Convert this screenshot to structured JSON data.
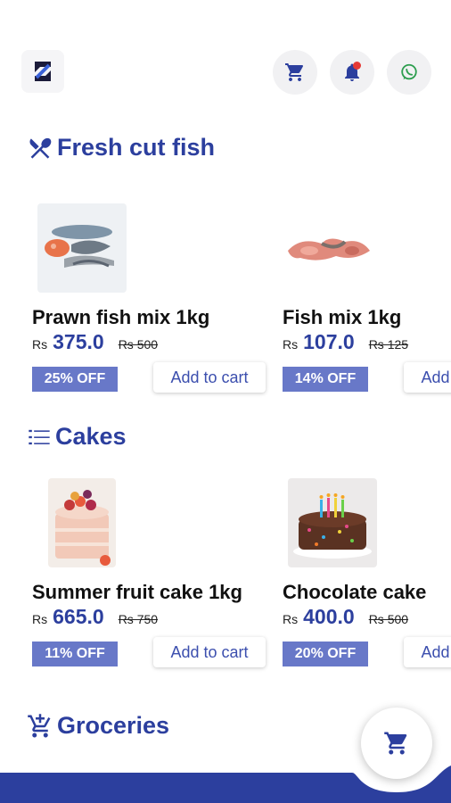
{
  "header": {
    "logo_icon": "brand-logo-icon",
    "cart_icon": "cart-icon",
    "notification_icon": "bell-icon",
    "whatsapp_icon": "whatsapp-icon"
  },
  "sections": [
    {
      "title": "Fresh cut fish",
      "icon": "fork-knife-icon",
      "products": [
        {
          "name": "Prawn fish mix 1kg",
          "currency": "Rs",
          "price": "375.0",
          "mrp": "Rs 500",
          "discount": "25% OFF",
          "cta": "Add to cart"
        },
        {
          "name": "Fish mix 1kg",
          "currency": "Rs",
          "price": "107.0",
          "mrp": "Rs 125",
          "discount": "14% OFF",
          "cta": "Add to cart"
        }
      ]
    },
    {
      "title": "Cakes",
      "icon": "list-icon",
      "products": [
        {
          "name": "Summer fruit cake 1kg",
          "currency": "Rs",
          "price": "665.0",
          "mrp": "Rs 750",
          "discount": "11% OFF",
          "cta": "Add to cart"
        },
        {
          "name": "Chocolate cake",
          "currency": "Rs",
          "price": "400.0",
          "mrp": "Rs 500",
          "discount": "20% OFF",
          "cta": "Add to cart"
        }
      ]
    },
    {
      "title": "Groceries",
      "icon": "cart-plus-icon"
    }
  ],
  "fab": {
    "icon": "cart-icon"
  },
  "colors": {
    "primary": "#2c3f9e",
    "discount_bg": "#6878c8",
    "strike": "#222222"
  }
}
